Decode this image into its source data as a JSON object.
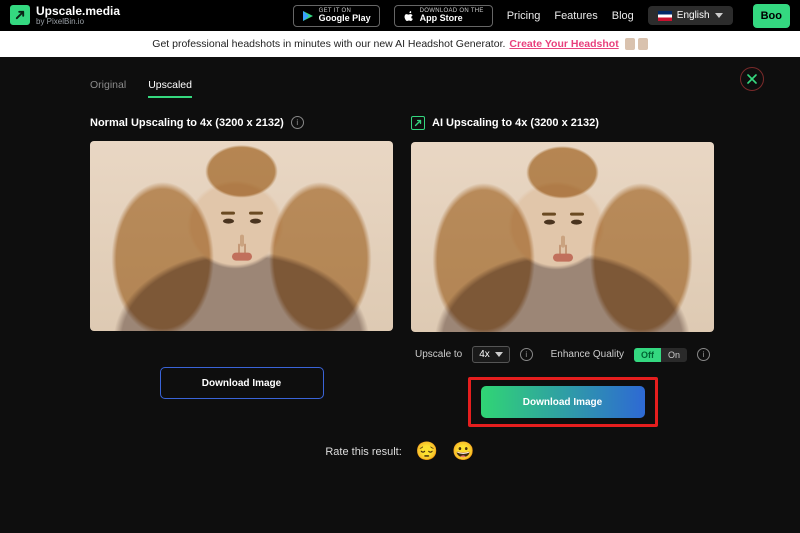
{
  "brand": {
    "name": "Upscale.media",
    "sub": "by PixelBin.io"
  },
  "store": {
    "google": {
      "top": "GET IT ON",
      "name": "Google Play"
    },
    "apple": {
      "top": "Download on the",
      "name": "App Store"
    }
  },
  "nav": {
    "pricing": "Pricing",
    "features": "Features",
    "blog": "Blog"
  },
  "lang": {
    "label": "English"
  },
  "boost": {
    "label": "Boo"
  },
  "promo": {
    "text": "Get professional headshots in minutes with our new AI Headshot Generator.",
    "cta": "Create Your Headshot"
  },
  "tabs": {
    "original": "Original",
    "upscaled": "Upscaled"
  },
  "left": {
    "title": "Normal Upscaling to 4x (3200 x 2132)",
    "download": "Download Image"
  },
  "right": {
    "title": "AI Upscaling to 4x (3200 x 2132)",
    "upscale_to": "Upscale to",
    "upscale_value": "4x",
    "enhance": "Enhance Quality",
    "off": "Off",
    "on": "On",
    "download": "Download Image"
  },
  "rate": {
    "label": "Rate this result:"
  }
}
